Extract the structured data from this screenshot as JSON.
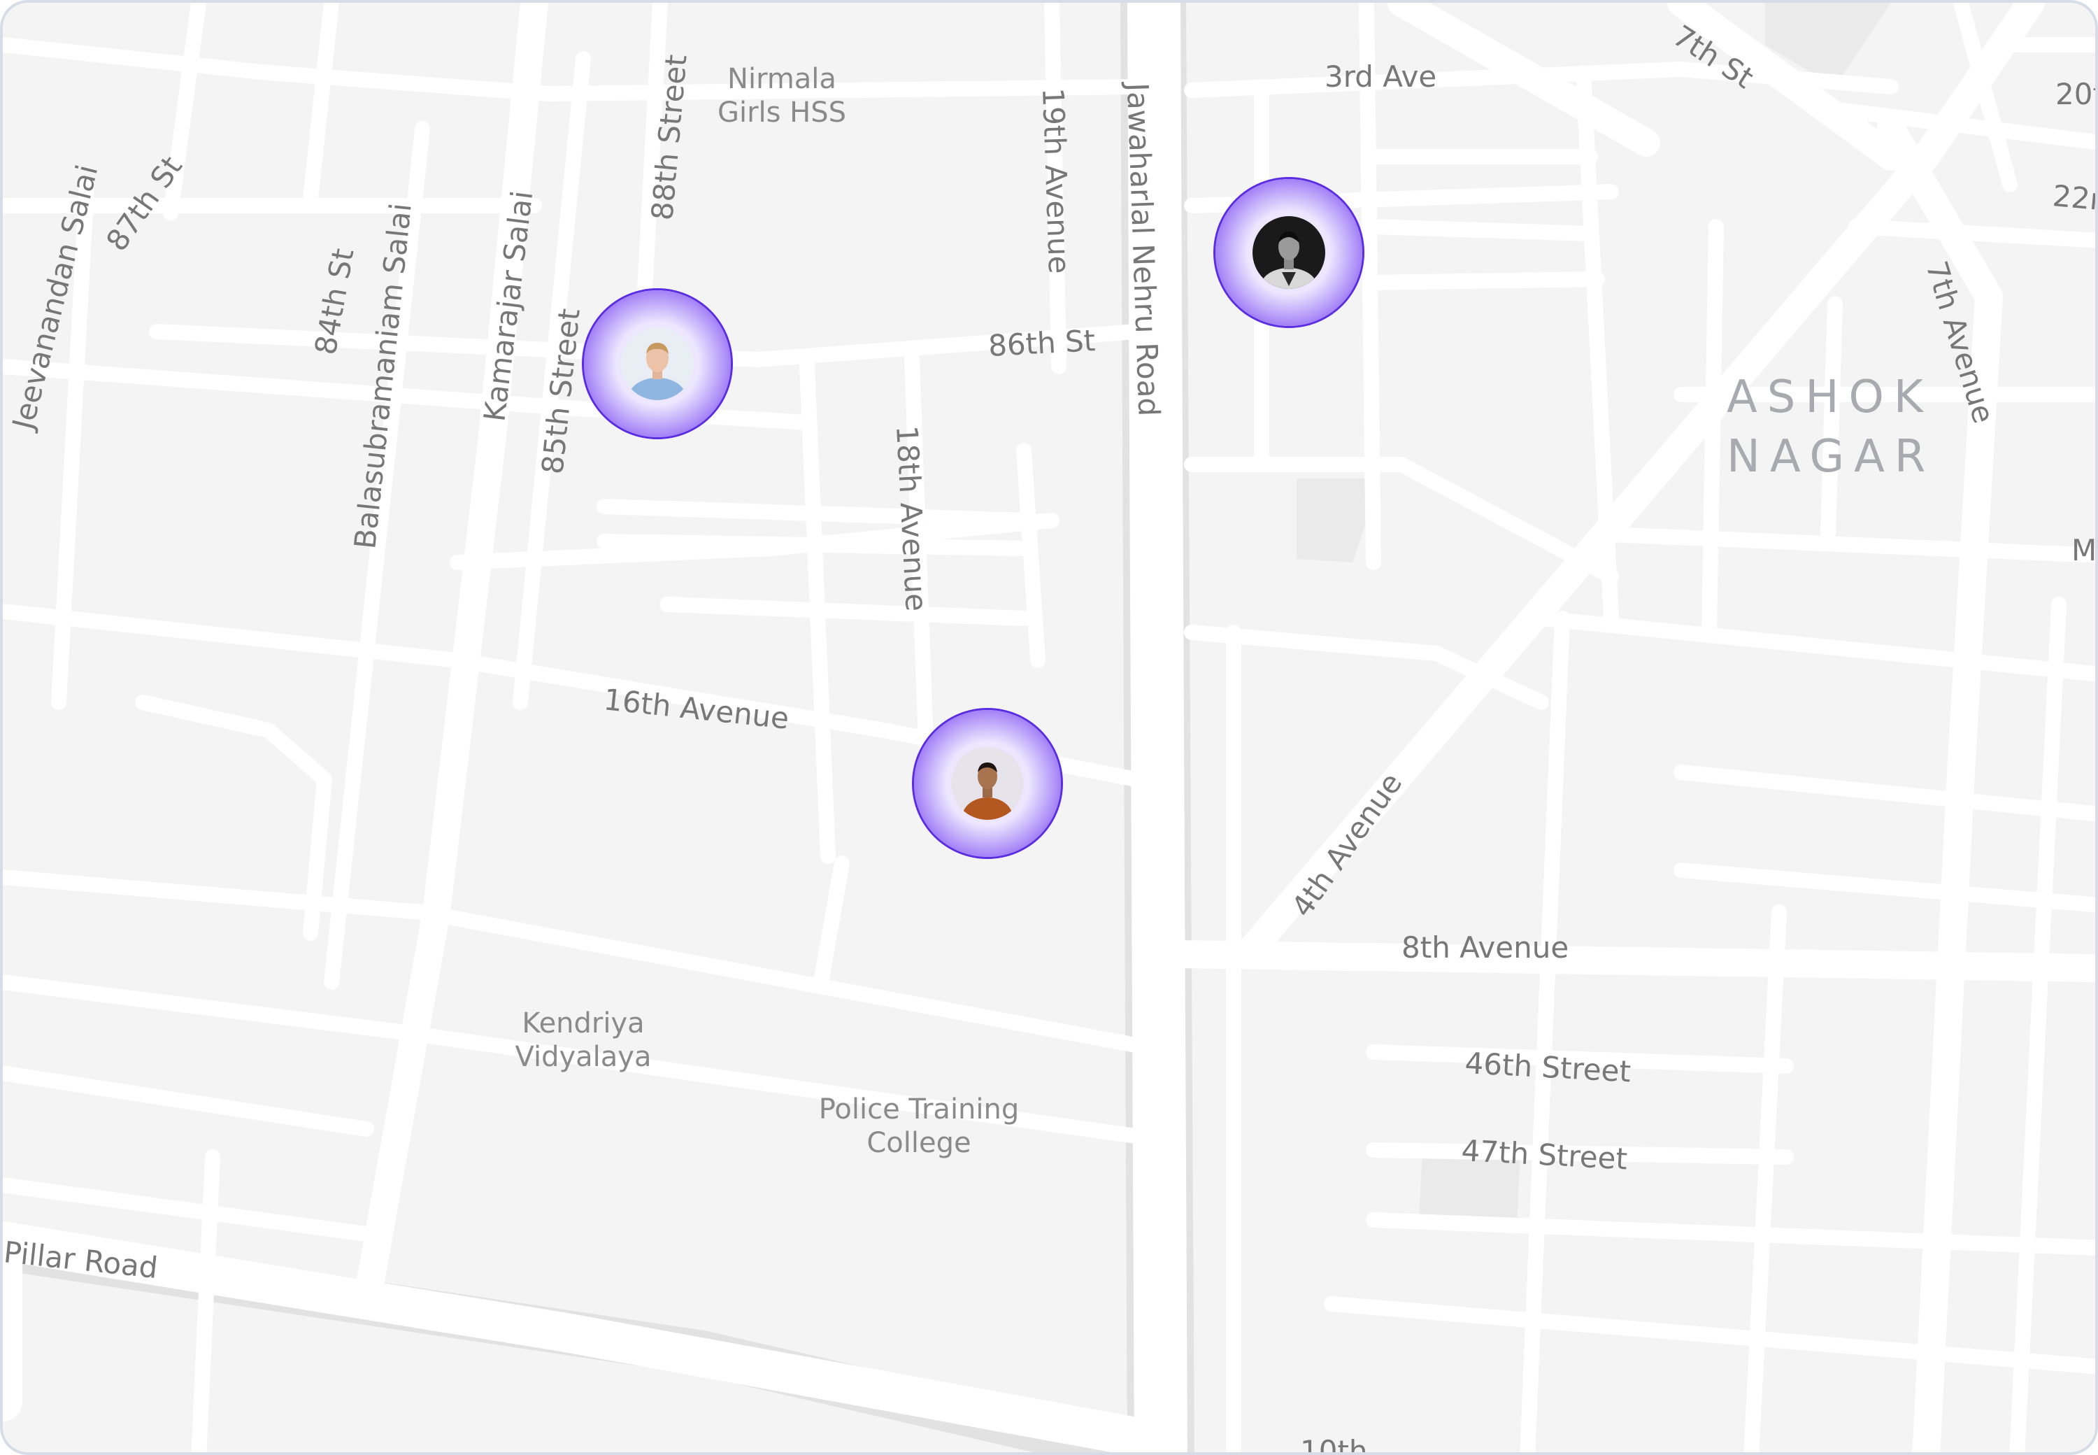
{
  "map": {
    "streets": {
      "third_ave": "3rd Ave",
      "seventh_st": "7th St",
      "twentieth": "20t",
      "twenty_second": "22n",
      "seventh_avenue": "7th Avenue",
      "eighty_sixth_st": "86th St",
      "eighty_eighth_street": "88th Street",
      "nineteenth_avenue": "19th Avenue",
      "jawaharlal_nehru_road": "Jawaharlal Nehru Road",
      "eighteenth_avenue": "18th Avenue",
      "kamarajar_salai": "Kamarajar Salai",
      "eighty_fifth_street": "85th Street",
      "balasubramaniam_salai": "Balasubramaniam Salai",
      "eighty_fourth_st": "84th St",
      "eighty_seventh_st": "87th St",
      "jeevanandan_salai": "Jeevanandan Salai",
      "sixteenth_avenue": "16th Avenue",
      "fourth_avenue": "4th Avenue",
      "eighth_avenue": "8th Avenue",
      "forty_sixth_street": "46th Street",
      "forty_seventh_street": "47th Street",
      "pillar_road": "Pillar Road",
      "tenth_partial": "10th",
      "m_partial": "M"
    },
    "pois": {
      "nirmala_line1": "Nirmala",
      "nirmala_line2": "Girls HSS",
      "kendriya_line1": "Kendriya",
      "kendriya_line2": "Vidyalaya",
      "police_line1": "Police Training",
      "police_line2": "College"
    },
    "areas": {
      "ashok_line1": "ASHOK",
      "ashok_line2": "NAGAR"
    }
  },
  "markers": [
    {
      "person": "man-light-blue-shirt-avatar"
    },
    {
      "person": "man-black-and-white-portrait-avatar"
    },
    {
      "person": "man-orange-jacket-avatar"
    }
  ],
  "colors": {
    "background": "#f4f4f4",
    "road": "#ffffff",
    "label": "#777777",
    "area_label": "#a9aab0",
    "marker_ring": "#5b2de2",
    "marker_glow": "#a98af7"
  }
}
